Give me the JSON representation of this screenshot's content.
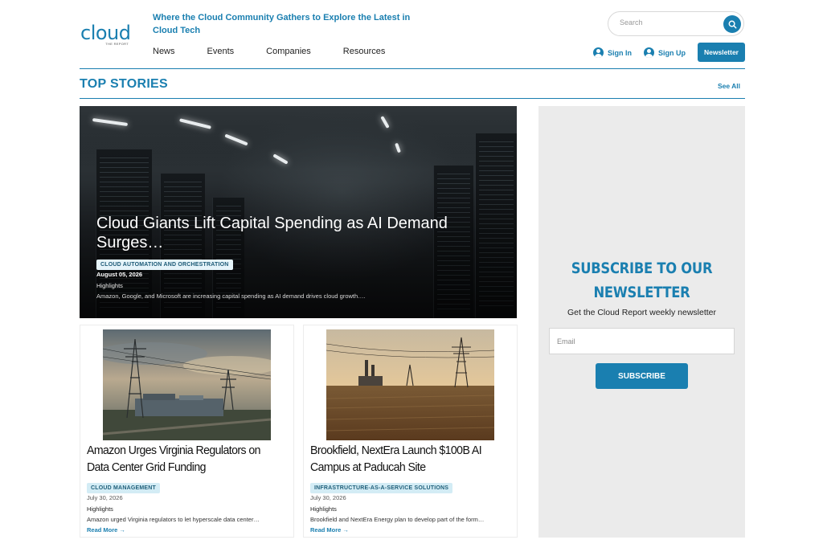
{
  "header": {
    "logo_text": "cloud",
    "logo_sub": "THE REPORT",
    "tagline": "Where the Cloud Community Gathers to Explore the Latest in Cloud Tech",
    "nav": [
      "News",
      "Events",
      "Companies",
      "Resources"
    ],
    "search_placeholder": "Search",
    "sign_in_label": "Sign In",
    "sign_up_label": "Sign Up",
    "newsletter_label": "Newsletter"
  },
  "section": {
    "title": "TOP STORIES",
    "see_all": "See All"
  },
  "hero": {
    "title": "Cloud Giants Lift Capital Spending as AI Demand Surges…",
    "category": "CLOUD AUTOMATION AND ORCHESTRATION",
    "date": "August 05, 2026",
    "kicker": "Highlights",
    "excerpt": "Amazon, Google, and Microsoft are increasing capital spending as AI demand drives cloud growth…."
  },
  "cards": [
    {
      "title": "Amazon Urges Virginia Regulators on Data Center Grid Funding",
      "category": "CLOUD MANAGEMENT",
      "date": "July 30, 2026",
      "kicker": "Highlights",
      "excerpt": "Amazon urged Virginia regulators to let hyperscale data center…",
      "read_more": "Read More →"
    },
    {
      "title": "Brookfield, NextEra Launch $100B AI Campus at Paducah Site",
      "category": "INFRASTRUCTURE-AS-A-SERVICE SOLUTIONS",
      "date": "July 30, 2026",
      "kicker": "Highlights",
      "excerpt": "Brookfield and NextEra Energy plan to develop part of the form…",
      "read_more": "Read More →"
    }
  ],
  "sidebar": {
    "title": "SUBSCRIBE TO OUR NEWSLETTER",
    "subtitle": "Get the Cloud Report weekly newsletter",
    "email_placeholder": "Email",
    "button": "SUBSCRIBE"
  },
  "colors": {
    "brand": "#1a7fb0",
    "category_bg": "#d3ecf5",
    "sidebar_bg": "#ebebeb"
  },
  "icons": [
    "search-icon",
    "user-icon",
    "arrow-right-icon"
  ]
}
